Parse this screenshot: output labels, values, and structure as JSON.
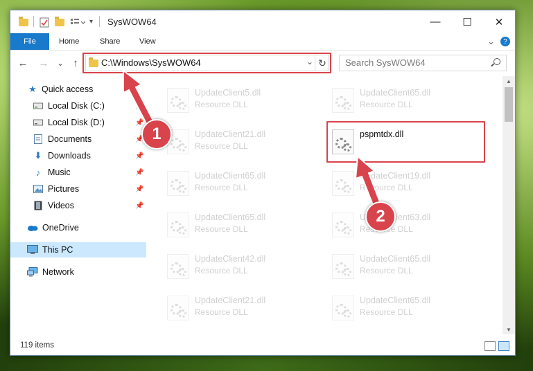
{
  "window": {
    "title": "SysWOW64",
    "minimize": "—",
    "maximize": "☐",
    "close": "✕"
  },
  "ribbon": {
    "tabs": [
      "File",
      "Home",
      "Share",
      "View"
    ],
    "collapse": "⌄",
    "help": "?"
  },
  "nav": {
    "back": "←",
    "forward": "→",
    "recent": "⌄",
    "up": "↑",
    "address": "C:\\Windows\\SysWOW64",
    "address_dropdown": "⌄",
    "refresh": "↻",
    "search_placeholder": "Search SysWOW64"
  },
  "sidebar": {
    "items": [
      {
        "label": "Quick access",
        "icon": "star-icon",
        "pinned": false
      },
      {
        "label": "Local Disk (C:)",
        "icon": "drive-icon",
        "pinned": true
      },
      {
        "label": "Local Disk (D:)",
        "icon": "drive-icon",
        "pinned": true
      },
      {
        "label": "Documents",
        "icon": "documents-icon",
        "pinned": true
      },
      {
        "label": "Downloads",
        "icon": "download-icon",
        "pinned": true
      },
      {
        "label": "Music",
        "icon": "music-icon",
        "pinned": true
      },
      {
        "label": "Pictures",
        "icon": "pictures-icon",
        "pinned": true
      },
      {
        "label": "Videos",
        "icon": "videos-icon",
        "pinned": true
      },
      {
        "label": "OneDrive",
        "icon": "cloud-icon",
        "pinned": false
      },
      {
        "label": "This PC",
        "icon": "computer-icon",
        "pinned": false,
        "selected": true
      },
      {
        "label": "Network",
        "icon": "network-icon",
        "pinned": false
      }
    ]
  },
  "files": [
    {
      "name": "UpdateClient5.dll",
      "type": "Resource DLL",
      "faded": true
    },
    {
      "name": "UpdateClient65.dll",
      "type": "Resource DLL",
      "faded": true
    },
    {
      "name": "UpdateClient21.dll",
      "type": "Resource DLL",
      "faded": true
    },
    {
      "name": "pspmtdx.dll",
      "type": "",
      "faded": false
    },
    {
      "name": "UpdateClient65.dll",
      "type": "Resource DLL",
      "faded": true
    },
    {
      "name": "UpdateClient19.dll",
      "type": "Resource DLL",
      "faded": true
    },
    {
      "name": "UpdateClient65.dll",
      "type": "Resource DLL",
      "faded": true
    },
    {
      "name": "UpdateClient63.dll",
      "type": "Resource DLL",
      "faded": true
    },
    {
      "name": "UpdateClient42.dll",
      "type": "Resource DLL",
      "faded": true
    },
    {
      "name": "UpdateClient65.dll",
      "type": "Resource DLL",
      "faded": true
    },
    {
      "name": "UpdateClient21.dll",
      "type": "Resource DLL",
      "faded": true
    },
    {
      "name": "UpdateClient65.dll",
      "type": "Resource DLL",
      "faded": true
    }
  ],
  "status": {
    "item_count": "119 items"
  },
  "annotations": {
    "step1": "1",
    "step2": "2",
    "color": "#d9434b"
  }
}
